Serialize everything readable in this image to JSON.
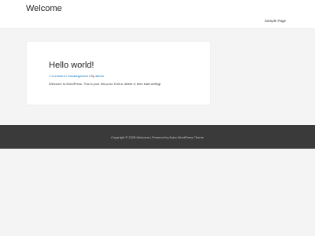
{
  "header": {
    "site_title": "Welcome",
    "nav": {
      "sample_page": "Sample Page"
    }
  },
  "post": {
    "title": "Hello world!",
    "meta": {
      "comments": "1 Comment",
      "sep1": " / ",
      "category": "Uncategorized",
      "sep2": " / ",
      "by_prefix": "By ",
      "author": "admin"
    },
    "content": "Welcome to WordPress. This is your first post. Edit or delete it, then start writing!"
  },
  "footer": {
    "text": "Copyright © 2026 Welcome | Powered by Astra WordPress Theme"
  }
}
